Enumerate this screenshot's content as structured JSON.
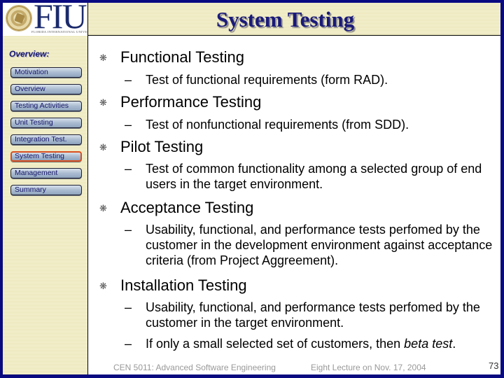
{
  "header": {
    "logo_text": "FIU",
    "logo_subtitle": "FLORIDA INTERNATIONAL UNIVERSITY",
    "title": "System Testing"
  },
  "sidebar": {
    "heading": "Overview:",
    "items": [
      {
        "label": "Motivation",
        "active": false
      },
      {
        "label": "Overview",
        "active": false
      },
      {
        "label": "Testing Activities",
        "active": false
      },
      {
        "label": "Unit Testing",
        "active": false
      },
      {
        "label": "Integration Test.",
        "active": false
      },
      {
        "label": "System Testing",
        "active": true
      },
      {
        "label": "Management",
        "active": false
      },
      {
        "label": "Summary",
        "active": false
      }
    ],
    "active_color": "#d84d1c"
  },
  "content": {
    "bullet_glyph": "❋",
    "dash_glyph": "–",
    "items": [
      {
        "title": "Functional Testing",
        "subs": [
          {
            "text": "Test of functional requirements (form RAD)."
          }
        ]
      },
      {
        "title": "Performance Testing",
        "subs": [
          {
            "text": "Test of nonfunctional requirements (from SDD)."
          }
        ]
      },
      {
        "title": "Pilot Testing",
        "subs": [
          {
            "text": "Test of common functionality among a selected group of end users in the target environment."
          }
        ]
      },
      {
        "title": "Acceptance Testing",
        "subs": [
          {
            "text": "Usability, functional, and performance tests perfomed by the customer in the development environment against acceptance criteria (from Project Aggreement)."
          }
        ]
      },
      {
        "title": "Installation Testing",
        "subs": [
          {
            "text": "Usability, functional, and performance tests perfomed by the customer in the target environment."
          },
          {
            "text_before": "If only a small selected set of customers, then ",
            "emphasis": "beta test",
            "text_after": "."
          }
        ]
      }
    ]
  },
  "footer": {
    "course": "CEN 5011: Advanced Software Engineering",
    "lecture": "Eight Lecture on Nov. 17, 2004",
    "page_number": "73"
  },
  "colors": {
    "frame": "#0a0a80",
    "title": "#1a1a7a",
    "header_stripe": "#f3efc9"
  }
}
